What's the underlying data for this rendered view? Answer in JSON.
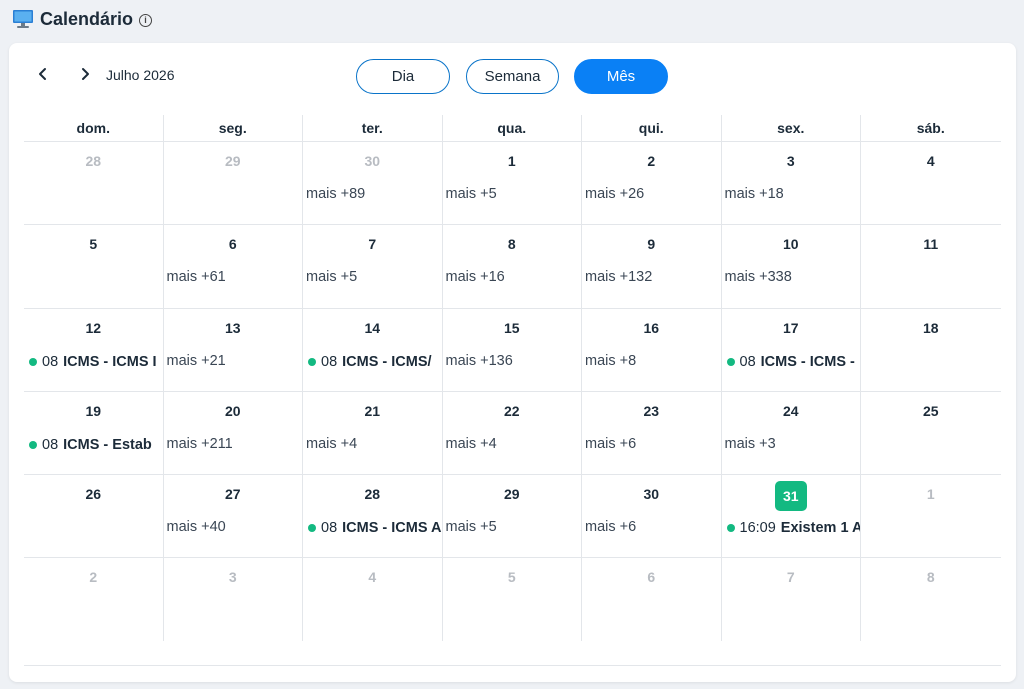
{
  "header": {
    "title": "Calendário",
    "info_icon": "info-icon",
    "app_icon": "monitor-icon"
  },
  "toolbar": {
    "prev_icon": "chevron-left-icon",
    "next_icon": "chevron-right-icon",
    "month_label": "Julho 2026",
    "views": [
      "Dia",
      "Semana",
      "Mês"
    ],
    "active_view": "Mês"
  },
  "colors": {
    "accent": "#0a80f5",
    "today": "#13b981",
    "event_dot": "#13b981"
  },
  "weekdays": [
    "dom.",
    "seg.",
    "ter.",
    "qua.",
    "qui.",
    "sex.",
    "sáb."
  ],
  "weeks": [
    [
      {
        "day": "28",
        "out": true
      },
      {
        "day": "29",
        "out": true
      },
      {
        "day": "30",
        "out": true,
        "more": "mais +89"
      },
      {
        "day": "1",
        "more": "mais +5"
      },
      {
        "day": "2",
        "more": "mais +26"
      },
      {
        "day": "3",
        "more": "mais +18"
      },
      {
        "day": "4"
      }
    ],
    [
      {
        "day": "5"
      },
      {
        "day": "6",
        "more": "mais +61"
      },
      {
        "day": "7",
        "more": "mais +5"
      },
      {
        "day": "8",
        "more": "mais +16"
      },
      {
        "day": "9",
        "more": "mais +132"
      },
      {
        "day": "10",
        "more": "mais +338"
      },
      {
        "day": "11"
      }
    ],
    [
      {
        "day": "12",
        "event": {
          "time": "08",
          "title": "ICMS - ICMS I"
        }
      },
      {
        "day": "13",
        "more": "mais +21"
      },
      {
        "day": "14",
        "event": {
          "time": "08",
          "title": "ICMS - ICMS/"
        }
      },
      {
        "day": "15",
        "more": "mais +136"
      },
      {
        "day": "16",
        "more": "mais +8"
      },
      {
        "day": "17",
        "event": {
          "time": "08",
          "title": "ICMS - ICMS -"
        }
      },
      {
        "day": "18"
      }
    ],
    [
      {
        "day": "19",
        "event": {
          "time": "08",
          "title": "ICMS - Estab"
        }
      },
      {
        "day": "20",
        "more": "mais +211"
      },
      {
        "day": "21",
        "more": "mais +4"
      },
      {
        "day": "22",
        "more": "mais +4"
      },
      {
        "day": "23",
        "more": "mais +6"
      },
      {
        "day": "24",
        "more": "mais +3"
      },
      {
        "day": "25"
      }
    ],
    [
      {
        "day": "26"
      },
      {
        "day": "27",
        "more": "mais +40"
      },
      {
        "day": "28",
        "event": {
          "time": "08",
          "title": "ICMS - ICMS A"
        }
      },
      {
        "day": "29",
        "more": "mais +5"
      },
      {
        "day": "30",
        "more": "mais +6"
      },
      {
        "day": "31",
        "today": true,
        "event": {
          "time": "16:09",
          "title": "Existem 1 A"
        }
      },
      {
        "day": "1",
        "out": true
      }
    ],
    [
      {
        "day": "2",
        "out": true
      },
      {
        "day": "3",
        "out": true
      },
      {
        "day": "4",
        "out": true
      },
      {
        "day": "5",
        "out": true
      },
      {
        "day": "6",
        "out": true
      },
      {
        "day": "7",
        "out": true
      },
      {
        "day": "8",
        "out": true
      }
    ]
  ]
}
